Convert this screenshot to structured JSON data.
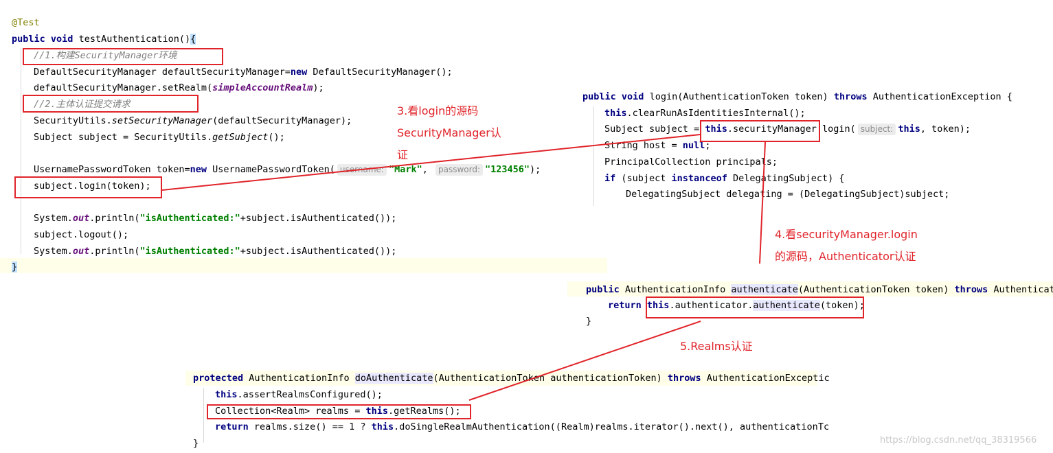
{
  "left_panel": {
    "annotation": "@Test",
    "line_sig_kw1": "public",
    "line_sig_kw2": "void",
    "line_sig_rest": "testAuthentication()",
    "line_sig_brace": "{",
    "comment1": "//1.构建SecurityManager环境",
    "line_dsm_a": "DefaultSecurityManager defaultSecurityManager=",
    "line_dsm_kw": "new",
    "line_dsm_b": " DefaultSecurityManager();",
    "line_setrealm_a": "defaultSecurityManager.setRealm(",
    "line_setrealm_field": "simpleAccountRealm",
    "line_setrealm_b": ");",
    "comment2": "//2.主体认证提交请求",
    "line_su_a": "SecurityUtils.",
    "line_su_method": "setSecurityManager",
    "line_su_b": "(defaultSecurityManager);",
    "line_subj_a": "Subject subject = SecurityUtils.",
    "line_subj_method": "getSubject",
    "line_subj_b": "();",
    "line_token_a": "UsernamePasswordToken token=",
    "line_token_kw": "new",
    "line_token_b": " UsernamePasswordToken(",
    "hint_username": "username:",
    "token_user": "\"Mark\"",
    "hint_password": "password:",
    "token_pass": "\"123456\"",
    "line_token_c": ");",
    "line_login": "subject.login(token);",
    "line_print1_a": "System.",
    "line_print1_out": "out",
    "line_print1_b": ".println(",
    "line_print1_str": "\"isAuthenticated:\"",
    "line_print1_c": "+subject.isAuthenticated());",
    "line_logout": "subject.logout();",
    "closing_brace": "}"
  },
  "login_panel": {
    "sig_kw1": "public",
    "sig_kw2": "void",
    "sig_a": "login(AuthenticationToken token)",
    "sig_throws": "throws",
    "sig_b": "AuthenticationException {",
    "line1_kw": "this",
    "line1_rest": ".clearRunAsIdentitiesInternal();",
    "line2_a": "Subject subject = ",
    "line2_kw": "this",
    "line2_b": ".securityManager.login(",
    "hint_subject": "subject:",
    "line2_kw2": "this",
    "line2_c": ", token);",
    "line3_a": "String host = ",
    "line3_kw": "null",
    "line3_b": ";",
    "line4": "PrincipalCollection principals;",
    "line5_kw": "if",
    "line5_a": " (subject ",
    "line5_kw2": "instanceof",
    "line5_b": " DelegatingSubject) {",
    "line6": "DelegatingSubject delegating = (DelegatingSubject)subject;"
  },
  "auth_panel": {
    "sig_kw": "public",
    "sig_a": " AuthenticationInfo ",
    "sig_method": "authenticate",
    "sig_b": "(AuthenticationToken token) ",
    "sig_throws": "throws",
    "sig_c": " Authenticati",
    "ret_kw": "return",
    "ret_this": "this",
    "ret_a": ".authenticator.",
    "ret_method": "authenticate",
    "ret_b": "(token);",
    "close": "}"
  },
  "realm_panel": {
    "sig_kw": "protected",
    "sig_a": " AuthenticationInfo ",
    "sig_method": "doAuthenticate",
    "sig_b": "(AuthenticationToken authenticationToken) ",
    "sig_throws": "throws",
    "sig_c": " AuthenticationExceptic",
    "line1_kw": "this",
    "line1_rest": ".assertRealmsConfigured();",
    "line2_a": "Collection<Realm> realms = ",
    "line2_kw": "this",
    "line2_b": ".getRealms();",
    "line3_kw": "return",
    "line3_a": " realms.size() == 1 ? ",
    "line3_kw2": "this",
    "line3_b": ".doSingleRealmAuthentication((Realm)realms.iterator().next(), authenticationTc",
    "close": "}"
  },
  "notes": {
    "note3": "3.看login的源码\nSecurityManager认\n证",
    "note4": "4.看securityManager.login\n的源码，Authenticator认证",
    "note5": "5.Realms认证"
  },
  "watermark": "https://blog.csdn.net/qq_38319566",
  "colors": {
    "highlight_box": "#e0242a",
    "keyword": "#000080",
    "string": "#008000",
    "field": "#660e7a"
  }
}
